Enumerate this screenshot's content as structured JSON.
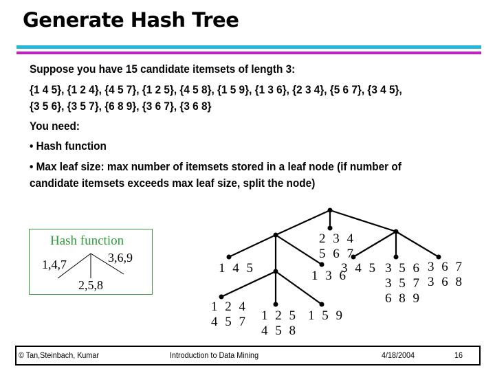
{
  "slide": {
    "title": "Generate Hash Tree",
    "accent_colors": {
      "top_bar": "#22b8d8",
      "bottom_bar": "#c41ec4",
      "hash_box": "#2e9a3a"
    },
    "intro": "Suppose you have 15 candidate itemsets of length 3:",
    "itemsets_line1": "{1 4 5}, {1 2 4}, {4 5 7}, {1 2 5}, {4 5 8}, {1 5 9}, {1 3 6}, {2 3 4}, {5 6 7}, {3 4 5},",
    "itemsets_line2": "{3 5 6}, {3 5 7}, {6 8 9}, {3 6 7}, {3 6 8}",
    "need_heading": "You need:",
    "bullet1": "• Hash function",
    "bullet2_line1": "• Max leaf size: max number of itemsets stored in a leaf node (if number of",
    "bullet2_line2": "candidate itemsets exceeds max leaf size, split the node)"
  },
  "hash_function": {
    "title": "Hash function",
    "left_branch": "1,4,7",
    "middle_branch": "2,5,8",
    "right_branch": "3,6,9"
  },
  "tree": {
    "leaves": {
      "l145": "1 4 5",
      "l124": "1 2 4\n4 5 7",
      "l125": "1 2 5\n4 5 8",
      "l159": "1 5 9",
      "l136": "1 3 6",
      "l234": "2 3 4\n5 6 7",
      "l345": "3 4 5",
      "l356": "3 5 6\n3 5 7\n6 8 9",
      "l367": "3 6 7\n3 6 8"
    }
  },
  "footer": {
    "authors": "© Tan,Steinbach, Kumar",
    "course": "Introduction to Data Mining",
    "date": "4/18/2004",
    "page": "16"
  }
}
